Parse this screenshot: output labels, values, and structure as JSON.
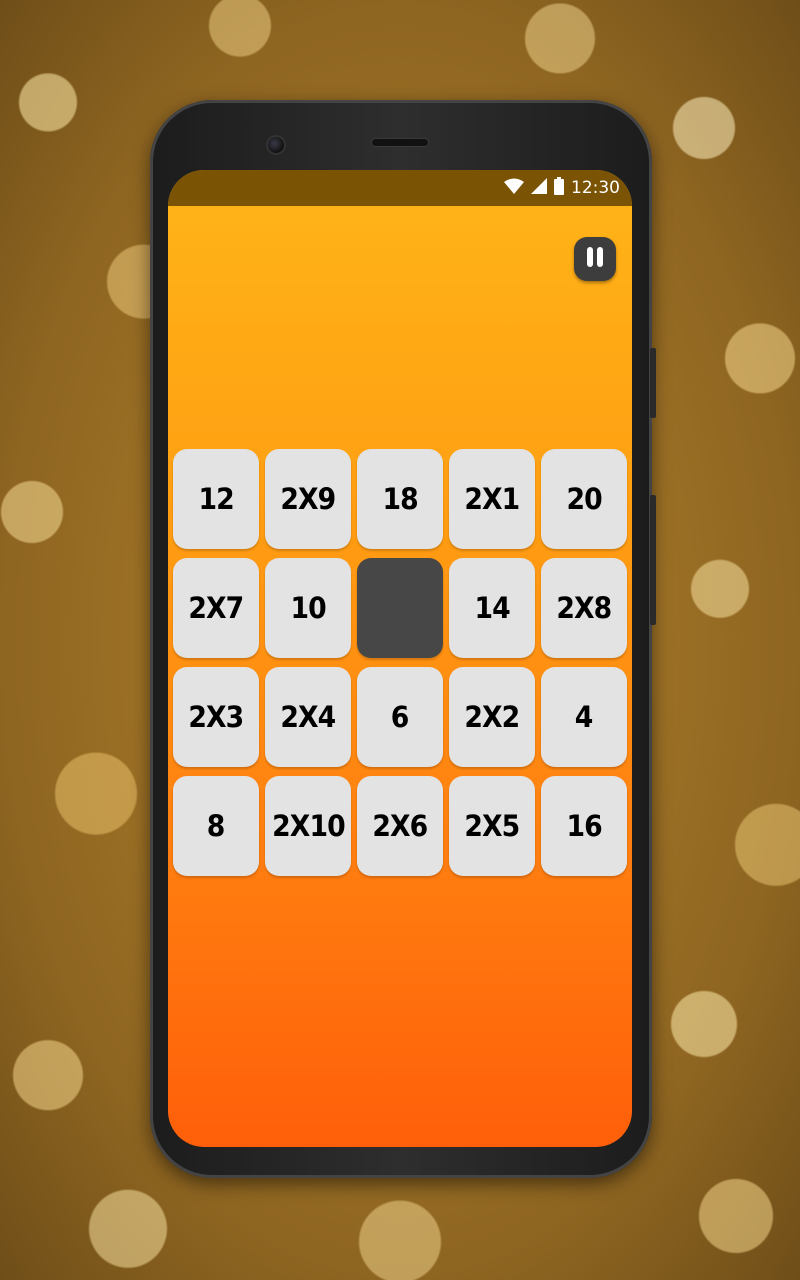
{
  "status_bar": {
    "time": "12:30",
    "icons": [
      "wifi-icon",
      "cellular-signal-icon",
      "battery-icon"
    ]
  },
  "controls": {
    "pause_icon": "pause-icon"
  },
  "colors": {
    "screen_gradient_top": "#ffb518",
    "screen_gradient_bottom": "#ff5f0a",
    "status_bar": "#7a5304",
    "tile": "#e3e3e3",
    "empty_tile": "#474747",
    "pause_button": "#3d3d3d"
  },
  "board": {
    "rows": 4,
    "columns": 5,
    "empty_slot": {
      "row": 2,
      "column": 3
    },
    "tiles": [
      [
        "12",
        "2X9",
        "18",
        "2X1",
        "20"
      ],
      [
        "2X7",
        "10",
        "",
        "14",
        "2X8"
      ],
      [
        "2X3",
        "2X4",
        "6",
        "2X2",
        "4"
      ],
      [
        "8",
        "2X10",
        "2X6",
        "2X5",
        "16"
      ]
    ]
  }
}
